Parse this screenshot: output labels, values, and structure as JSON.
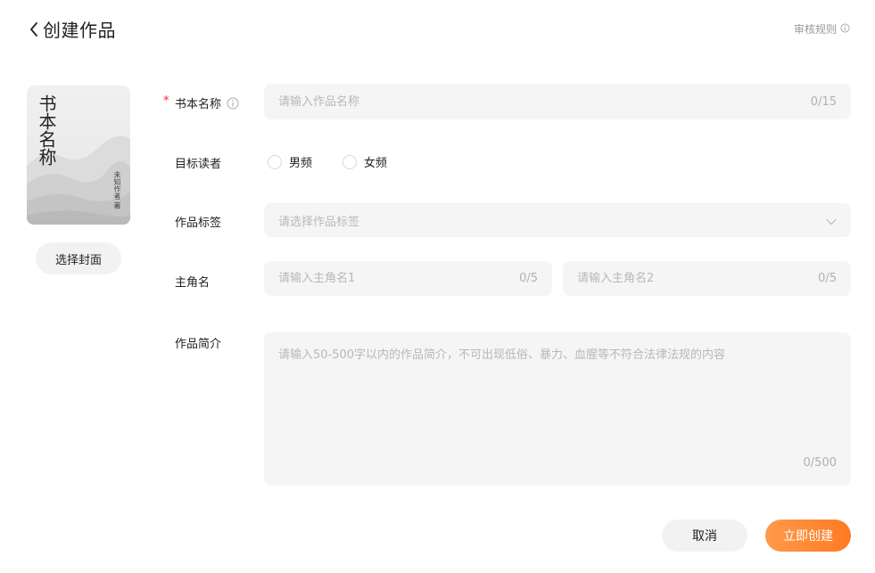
{
  "header": {
    "title": "创建作品",
    "rules_label": "审核规则"
  },
  "cover": {
    "title": "书本名称",
    "author": "未知作者 著",
    "choose_label": "选择封面"
  },
  "form": {
    "book_name": {
      "label": "书本名称",
      "required_mark": "*",
      "placeholder": "请输入作品名称",
      "counter": "0/15"
    },
    "target_reader": {
      "label": "目标读者",
      "options": [
        "男频",
        "女频"
      ]
    },
    "tags": {
      "label": "作品标签",
      "placeholder": "请选择作品标签"
    },
    "protagonist": {
      "label": "主角名",
      "placeholder_1": "请输入主角名1",
      "placeholder_2": "请输入主角名2",
      "counter_1": "0/5",
      "counter_2": "0/5"
    },
    "summary": {
      "label": "作品简介",
      "placeholder": "请输入50-500字以内的作品简介，不可出现低俗、暴力、血腥等不符合法律法规的内容",
      "counter": "0/500"
    }
  },
  "actions": {
    "cancel_label": "取消",
    "create_label": "立即创建"
  },
  "colors": {
    "accent": "#ff7a22",
    "required": "#f5222d",
    "field_bg": "#f5f5f5"
  }
}
